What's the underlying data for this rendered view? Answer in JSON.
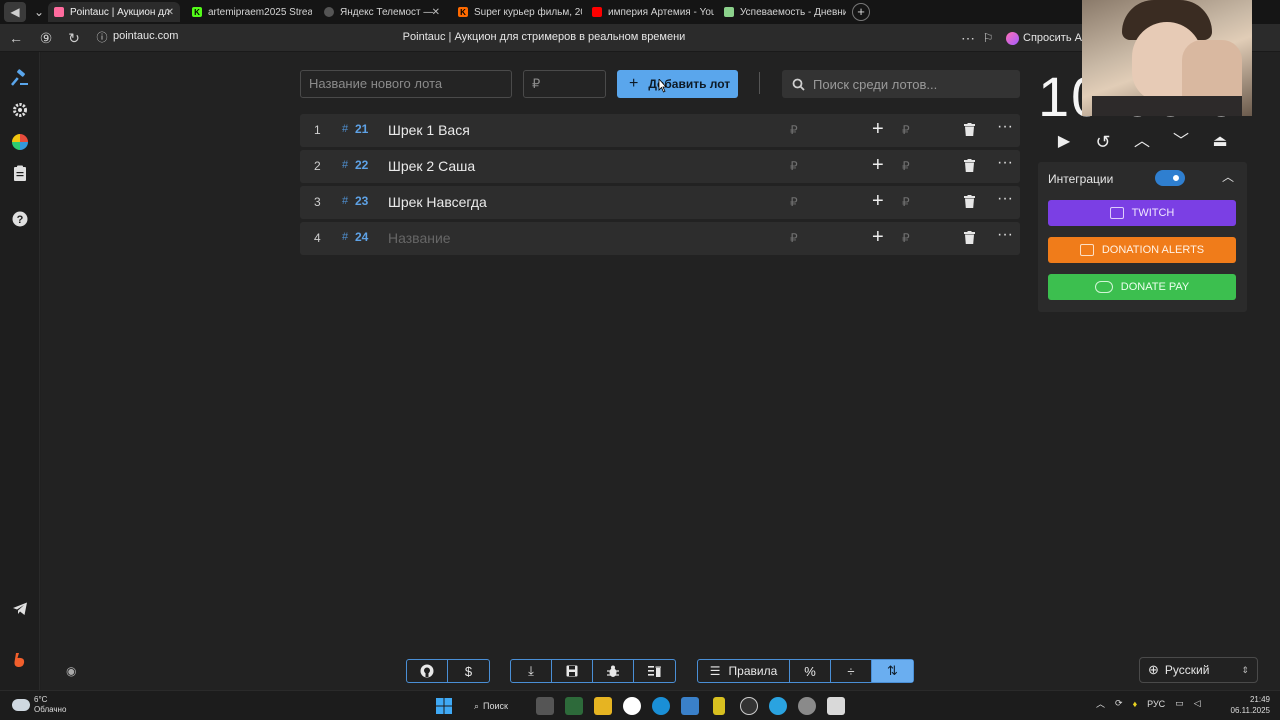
{
  "browser": {
    "tabs": [
      {
        "title": "Pointauc | Аукцион дл",
        "active": true
      },
      {
        "title": "artemipraem2025 Stream",
        "active": false
      },
      {
        "title": "Яндекс Телемост —",
        "active": false
      },
      {
        "title": "Super курьер фильм, 202",
        "active": false
      },
      {
        "title": "империя Артемия - YouTu",
        "active": false
      },
      {
        "title": "Успеваемость - Дневник",
        "active": false
      }
    ],
    "url": "pointauc.com",
    "page_title": "Pointauc | Аукцион для стримеров в реальном времени",
    "ask_ai": "Спросить Al"
  },
  "toolbar_top": {
    "lot_name_placeholder": "Название нового лота",
    "amount_placeholder": "₽",
    "add_lot_label": "Добавить лот",
    "search_placeholder": "Поиск среди лотов..."
  },
  "lots": [
    {
      "num": "1",
      "id": "21",
      "name": "Шрек 1 Вася",
      "placeholder": false
    },
    {
      "num": "2",
      "id": "22",
      "name": "Шрек 2 Саша",
      "placeholder": false
    },
    {
      "num": "3",
      "id": "23",
      "name": "Шрек Навсегда",
      "placeholder": false
    },
    {
      "num": "4",
      "id": "24",
      "name": "Название",
      "placeholder": true
    }
  ],
  "lot_row_symbols": {
    "hash": "#",
    "rub": "₽",
    "plus": "+",
    "more": "···"
  },
  "timer": {
    "display": "10:00:00"
  },
  "integrations": {
    "title": "Интеграции",
    "enabled": true,
    "buttons": [
      {
        "label": "TWITCH",
        "color": "#7b3fe4"
      },
      {
        "label": "DONATION ALERTS",
        "color": "#f07c1a"
      },
      {
        "label": "DONATE PAY",
        "color": "#3cbf4f"
      }
    ]
  },
  "bottom_toolbar": {
    "rules_label": "Правила",
    "percent_label": "%"
  },
  "language": {
    "selected": "Русский"
  },
  "taskbar": {
    "weather_temp": "6°C",
    "weather_desc": "Облачно",
    "search_label": "Поиск",
    "lang": "РУС",
    "time": "21:49",
    "date": "06.11.2025"
  },
  "colors": {
    "accent": "#5aa6ec",
    "lot_id": "#5ea2e6",
    "background": "#222222"
  }
}
